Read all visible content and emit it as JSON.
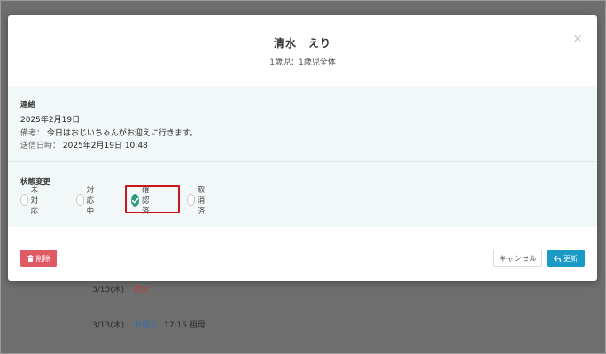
{
  "modal": {
    "title": "清水　えり",
    "subtitle": "1歳児：1歳児全体",
    "close_glyph": "×"
  },
  "contact": {
    "section_label": "連絡",
    "date": "2025年2月19日",
    "note_label": "備考：",
    "note_text": "今日はおじいちゃんがお迎えに行きます。",
    "sent_label": "送信日時：",
    "sent_value": "2025年2月19日 10:48"
  },
  "status": {
    "section_label": "状態変更",
    "options": [
      {
        "label": "未対応",
        "checked": false
      },
      {
        "label": "対応中",
        "checked": false
      },
      {
        "label": "確認済",
        "checked": true
      },
      {
        "label": "取消済",
        "checked": false
      }
    ],
    "highlight_color": "#c8161b",
    "checked_color": "#2e9a82"
  },
  "footer": {
    "delete_label": "削除",
    "delete_icon": "trash-icon",
    "cancel_label": "キャンセル",
    "update_label": "更新",
    "update_icon": "reply-arrow-icon"
  },
  "background_list": [
    {
      "date": "3/13(木)",
      "status": "病欠",
      "time": ""
    },
    {
      "date": "3/13(木)",
      "status": "お迎え",
      "time": "17:15 祖母"
    }
  ],
  "colors": {
    "delete": "#e05a66",
    "update": "#1a9bc5",
    "body_bg": "#f2f7f8"
  }
}
